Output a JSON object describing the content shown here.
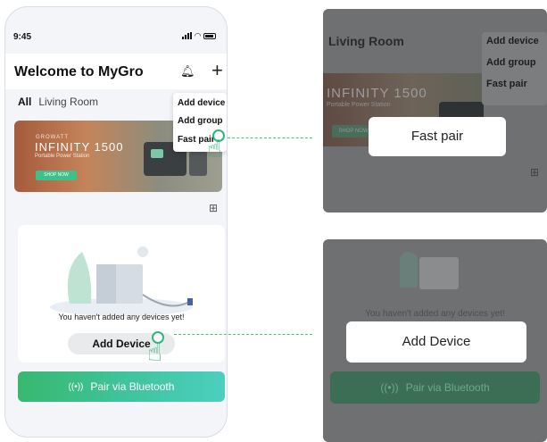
{
  "status": {
    "time": "9:45"
  },
  "header": {
    "title": "Welcome to MyGro"
  },
  "tabs": [
    "All",
    "Living Room"
  ],
  "menu": {
    "items": [
      "Add device",
      "Add group",
      "Fast pair"
    ]
  },
  "banner": {
    "brand": "GROWATT",
    "product": "INFINITY 1500",
    "subtitle": "Portable Power Station",
    "shop": "SHOP NOW"
  },
  "empty": {
    "message": "You haven't added any devices yet!",
    "add_button": "Add Device"
  },
  "pair": {
    "label": "Pair via Bluetooth",
    "icon": "((•))"
  },
  "zoom1": {
    "room": "Living Room",
    "menu_items": [
      "Add device",
      "Add group",
      "Fast pair"
    ],
    "product": "INFINITY 1500",
    "subtitle": "Portable Power Station",
    "shop": "SHOP NOW",
    "callout": "Fast pair"
  },
  "zoom2": {
    "message": "You haven't added any devices yet!",
    "callout": "Add Device",
    "pair_label": "Pair via Bluetooth"
  },
  "colors": {
    "accent": "#2fb67a",
    "pair_gradient_start": "#38b86f",
    "pair_gradient_end": "#4ccfbf"
  }
}
